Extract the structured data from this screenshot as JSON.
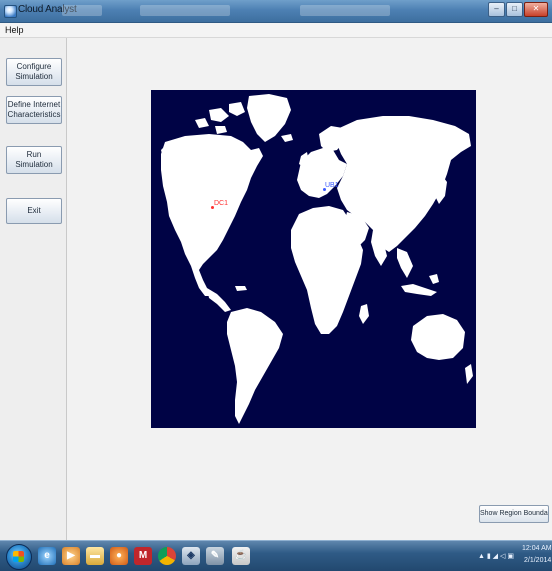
{
  "window": {
    "title": "Cloud Analyst",
    "controls": {
      "minimize": "–",
      "maximize": "□",
      "close": "✕"
    }
  },
  "menubar": {
    "help": "Help"
  },
  "sidebar": {
    "buttons": [
      {
        "id": "configure",
        "label": "Configure Simulation"
      },
      {
        "id": "internet",
        "label": "Define Internet Characteristics"
      },
      {
        "id": "run",
        "label": "Run Simulation"
      },
      {
        "id": "exit",
        "label": "Exit"
      }
    ]
  },
  "map": {
    "markers": [
      {
        "label": "DC1",
        "color": "#ff3030"
      },
      {
        "label": "UB1",
        "color": "#3b5bff"
      }
    ],
    "ocean_color": "#000345",
    "land_color": "#ffffff"
  },
  "show_region_button": "Show Region Boundaries",
  "taskbar": {
    "icons": [
      "start-orb",
      "ie-icon",
      "folder-icon",
      "explorer-icon",
      "firefox-icon",
      "m-app-icon",
      "chrome-icon",
      "shield-icon",
      "tool-icon",
      "java-icon"
    ],
    "clock_time": "12:04 AM",
    "clock_date": "2/1/2014"
  }
}
